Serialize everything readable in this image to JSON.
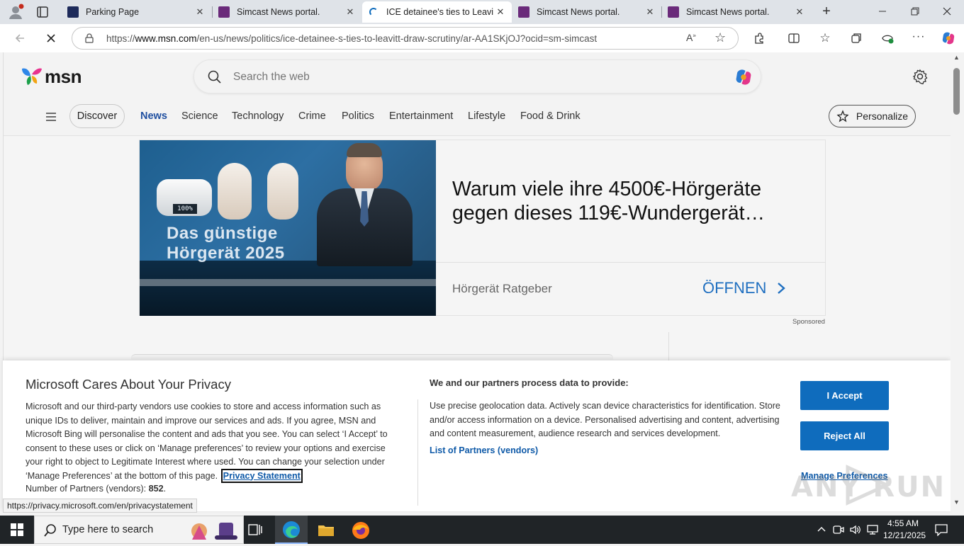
{
  "tabs": [
    {
      "title": "Parking Page"
    },
    {
      "title": "Simcast News portal."
    },
    {
      "title": "ICE detainee's ties to Leavitt"
    },
    {
      "title": "Simcast News portal."
    },
    {
      "title": "Simcast News portal."
    }
  ],
  "address": {
    "prefix": "https://",
    "domain": "www.msn.com",
    "path": "/en-us/news/politics/ice-detainee-s-ties-to-leavitt-draw-scrutiny/ar-AA1SKjOJ?ocid=sm-simcast"
  },
  "msn": {
    "logo_text": "msn",
    "search_placeholder": "Search the web",
    "nav": {
      "discover": "Discover",
      "items": [
        "News",
        "Science",
        "Technology",
        "Crime",
        "Politics",
        "Entertainment",
        "Lifestyle",
        "Food & Drink"
      ],
      "personalize": "Personalize"
    }
  },
  "ad": {
    "image_text_line1": "Das günstige",
    "image_text_line2": "Hörgerät 2025",
    "device_display": "100%",
    "headline": "Warum viele ihre 4500€-Hörgeräte gegen dieses 119€-Wundergerät…",
    "advertiser": "Hörgerät Ratgeber",
    "cta": "ÖFFNEN",
    "sponsored": "Sponsored"
  },
  "privacy": {
    "title": "Microsoft Cares About Your Privacy",
    "body": "Microsoft and our third-party vendors use cookies to store and access information such as unique IDs to deliver, maintain and improve our services and ads. If you agree, MSN and Microsoft Bing will personalise the content and ads that you see. You can select ‘I Accept’ to consent to these uses or click on ‘Manage preferences’ to review your options and exercise your right to object to Legitimate Interest where used.  You can change your selection under ‘Manage Preferences’ at the bottom of this page.",
    "privacy_link": "Privacy Statement",
    "partners_label": "Number of Partners (vendors):",
    "partners_count": "852",
    "partners_suffix": ".",
    "process_title": "We and our partners process data to provide:",
    "process_body": "Use precise geolocation data. Actively scan device characteristics for identification. Store and/or access information on a device. Personalised advertising and content, advertising and content measurement, audience research and services development.",
    "list_partners": "List of Partners (vendors)",
    "accept": "I Accept",
    "reject": "Reject All",
    "manage": "Manage Preferences"
  },
  "status_url": "https://privacy.microsoft.com/en/privacystatement",
  "watermark": "ANY RUN",
  "taskbar": {
    "search_placeholder": "Type here to search",
    "time": "4:55 AM",
    "date": "12/21/2025"
  },
  "colors": {
    "accent_blue": "#0f6cbd",
    "link_blue": "#0f5aa8",
    "nav_active": "#1f4fa0",
    "taskbar": "#202427"
  }
}
